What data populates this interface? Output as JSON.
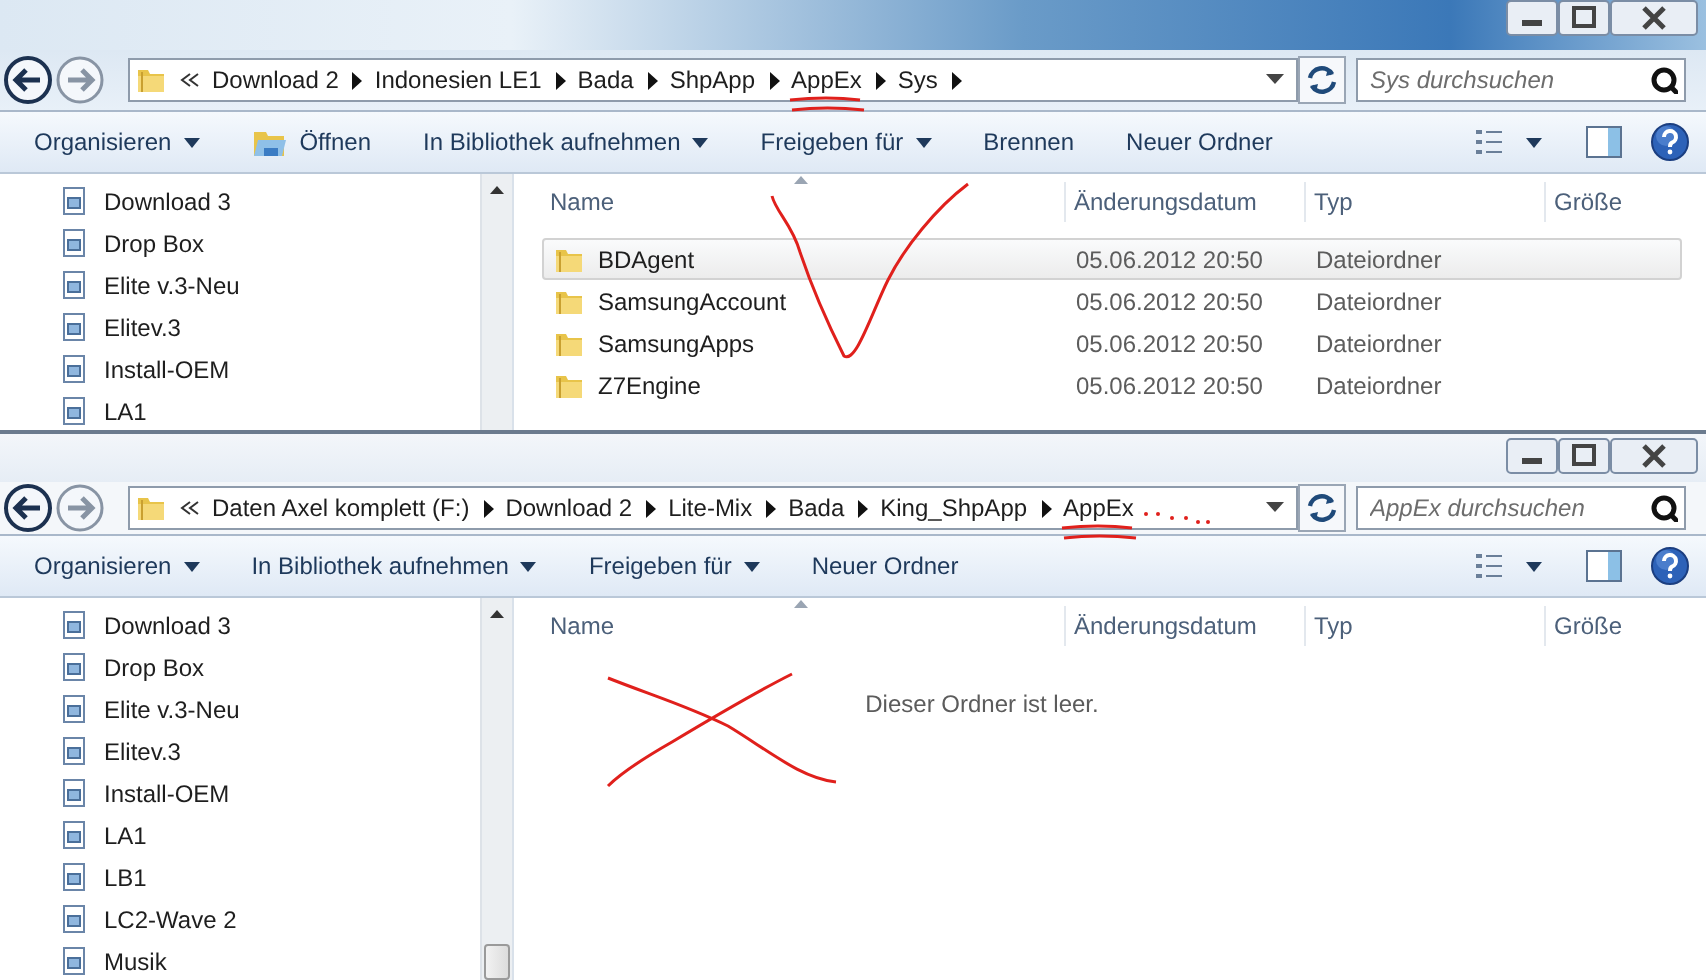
{
  "windows": [
    {
      "address": {
        "crumbs": [
          {
            "label": "Download 2",
            "underlined": false,
            "dotted_trail": false
          },
          {
            "label": "Indonesien LE1",
            "underlined": false,
            "dotted_trail": false
          },
          {
            "label": "Bada",
            "underlined": false,
            "dotted_trail": false
          },
          {
            "label": "ShpApp",
            "underlined": false,
            "dotted_trail": false
          },
          {
            "label": "AppEx",
            "underlined": true,
            "dotted_trail": false
          },
          {
            "label": "Sys",
            "underlined": false,
            "dotted_trail": false
          }
        ],
        "trailing_arrow": true
      },
      "search": {
        "placeholder": "Sys durchsuchen"
      },
      "toolbar": [
        {
          "label": "Organisieren",
          "kind": "dropdown"
        },
        {
          "label": "Öffnen",
          "kind": "icon-button"
        },
        {
          "label": "In Bibliothek aufnehmen",
          "kind": "dropdown"
        },
        {
          "label": "Freigeben für",
          "kind": "dropdown"
        },
        {
          "label": "Brennen",
          "kind": "button"
        },
        {
          "label": "Neuer Ordner",
          "kind": "button"
        }
      ],
      "nav_items": [
        "Download 3",
        "Drop Box",
        "Elite v.3-Neu",
        "Elitev.3",
        "Install-OEM",
        "LA1"
      ],
      "columns": [
        "Name",
        "Änderungsdatum",
        "Typ",
        "Größe"
      ],
      "rows": [
        {
          "name": "BDAgent",
          "date": "05.06.2012 20:50",
          "type": "Dateiordner",
          "selected": true
        },
        {
          "name": "SamsungAccount",
          "date": "05.06.2012 20:50",
          "type": "Dateiordner",
          "selected": false
        },
        {
          "name": "SamsungApps",
          "date": "05.06.2012 20:50",
          "type": "Dateiordner",
          "selected": false
        },
        {
          "name": "Z7Engine",
          "date": "05.06.2012 20:50",
          "type": "Dateiordner",
          "selected": false
        }
      ],
      "annotations": [
        {
          "kind": "check"
        }
      ]
    },
    {
      "address": {
        "crumbs": [
          {
            "label": "Daten Axel komplett (F:)",
            "underlined": false,
            "dotted_trail": false
          },
          {
            "label": "Download 2",
            "underlined": false,
            "dotted_trail": false
          },
          {
            "label": "Lite-Mix",
            "underlined": false,
            "dotted_trail": false
          },
          {
            "label": "Bada",
            "underlined": false,
            "dotted_trail": false
          },
          {
            "label": "King_ShpApp",
            "underlined": false,
            "dotted_trail": false
          },
          {
            "label": "AppEx",
            "underlined": true,
            "dotted_trail": true
          }
        ],
        "trailing_arrow": false
      },
      "search": {
        "placeholder": "AppEx durchsuchen"
      },
      "toolbar": [
        {
          "label": "Organisieren",
          "kind": "dropdown"
        },
        {
          "label": "In Bibliothek aufnehmen",
          "kind": "dropdown"
        },
        {
          "label": "Freigeben für",
          "kind": "dropdown"
        },
        {
          "label": "Neuer Ordner",
          "kind": "button"
        }
      ],
      "nav_items": [
        "Download 3",
        "Drop Box",
        "Elite v.3-Neu",
        "Elitev.3",
        "Install-OEM",
        "LA1",
        "LB1",
        "LC2-Wave 2",
        "Musik"
      ],
      "columns": [
        "Name",
        "Änderungsdatum",
        "Typ",
        "Größe"
      ],
      "empty_message": "Dieser Ordner ist leer.",
      "annotations": [
        {
          "kind": "cross"
        }
      ]
    }
  ]
}
